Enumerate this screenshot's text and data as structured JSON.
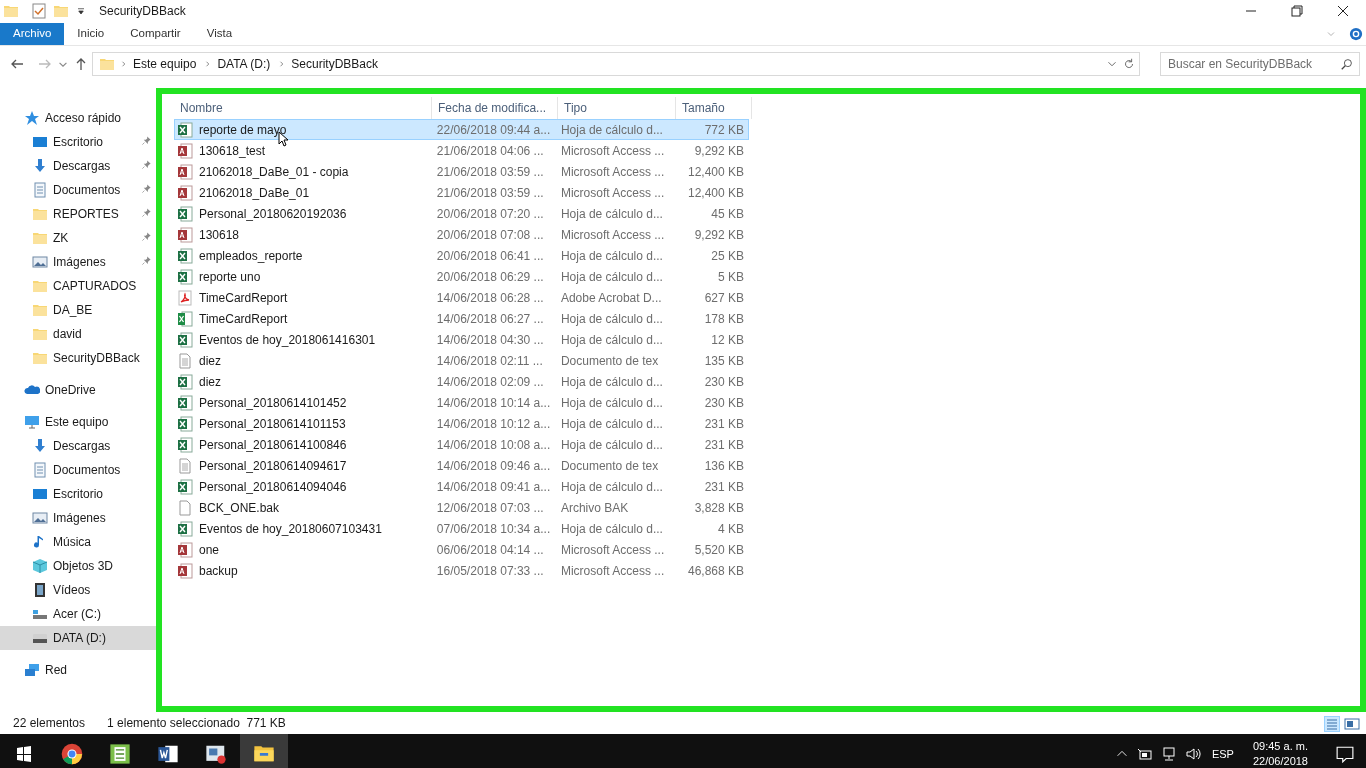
{
  "window": {
    "title": "SecurityDBBack"
  },
  "ribbon_tabs": [
    {
      "label": "Archivo",
      "selected": true
    },
    {
      "label": "Inicio",
      "selected": false
    },
    {
      "label": "Compartir",
      "selected": false
    },
    {
      "label": "Vista",
      "selected": false
    }
  ],
  "address": {
    "crumbs": [
      "Este equipo",
      "DATA (D:)",
      "SecurityDBBack"
    ]
  },
  "search": {
    "placeholder": "Buscar en SecurityDBBack"
  },
  "sidebar": {
    "items": [
      {
        "label": "Acceso rápido",
        "kind": "star",
        "selected": false,
        "children": [
          {
            "label": "Escritorio",
            "kind": "desktop",
            "pinned": true,
            "selected": false
          },
          {
            "label": "Descargas",
            "kind": "download",
            "pinned": true,
            "selected": false
          },
          {
            "label": "Documentos",
            "kind": "docs",
            "pinned": true,
            "selected": false
          },
          {
            "label": "REPORTES",
            "kind": "folder",
            "pinned": true,
            "selected": false
          },
          {
            "label": "ZK",
            "kind": "folder",
            "pinned": true,
            "selected": false
          },
          {
            "label": "Imágenes",
            "kind": "pictures",
            "pinned": true,
            "selected": false
          },
          {
            "label": "CAPTURADOS",
            "kind": "folder",
            "pinned": false,
            "selected": false
          },
          {
            "label": "DA_BE",
            "kind": "folder",
            "pinned": false,
            "selected": false
          },
          {
            "label": "david",
            "kind": "folder",
            "pinned": false,
            "selected": false
          },
          {
            "label": "SecurityDBBack",
            "kind": "folder",
            "pinned": false,
            "selected": false
          }
        ]
      },
      {
        "label": "OneDrive",
        "kind": "cloud",
        "selected": false
      },
      {
        "label": "Este equipo",
        "kind": "pc",
        "selected": false,
        "children": [
          {
            "label": "Descargas",
            "kind": "download",
            "pinned": false,
            "selected": false
          },
          {
            "label": "Documentos",
            "kind": "docs",
            "pinned": false,
            "selected": false
          },
          {
            "label": "Escritorio",
            "kind": "desktop",
            "pinned": false,
            "selected": false
          },
          {
            "label": "Imágenes",
            "kind": "pictures",
            "pinned": false,
            "selected": false
          },
          {
            "label": "Música",
            "kind": "music",
            "pinned": false,
            "selected": false
          },
          {
            "label": "Objetos 3D",
            "kind": "cube",
            "pinned": false,
            "selected": false
          },
          {
            "label": "Vídeos",
            "kind": "video",
            "pinned": false,
            "selected": false
          },
          {
            "label": "Acer (C:)",
            "kind": "drive-c",
            "pinned": false,
            "selected": false
          },
          {
            "label": "DATA (D:)",
            "kind": "drive",
            "pinned": false,
            "selected": true
          }
        ]
      },
      {
        "label": "Red",
        "kind": "network",
        "selected": false
      }
    ]
  },
  "table": {
    "columns": [
      "Nombre",
      "Fecha de modifica...",
      "Tipo",
      "Tamaño"
    ],
    "rows": [
      {
        "kind": "xlsx",
        "name": "reporte de mayo",
        "date": "22/06/2018 09:44 a...",
        "type": "Hoja de cálculo d...",
        "size": "772 KB",
        "selected": true
      },
      {
        "kind": "access",
        "name": "130618_test",
        "date": "21/06/2018 04:06 ...",
        "type": "Microsoft Access ...",
        "size": "9,292 KB",
        "selected": false
      },
      {
        "kind": "access",
        "name": "21062018_DaBe_01 - copia",
        "date": "21/06/2018 03:59 ...",
        "type": "Microsoft Access ...",
        "size": "12,400 KB",
        "selected": false
      },
      {
        "kind": "access",
        "name": "21062018_DaBe_01",
        "date": "21/06/2018 03:59 ...",
        "type": "Microsoft Access ...",
        "size": "12,400 KB",
        "selected": false
      },
      {
        "kind": "xlsx",
        "name": "Personal_20180620192036",
        "date": "20/06/2018 07:20 ...",
        "type": "Hoja de cálculo d...",
        "size": "45 KB",
        "selected": false
      },
      {
        "kind": "access",
        "name": "130618",
        "date": "20/06/2018 07:08 ...",
        "type": "Microsoft Access ...",
        "size": "9,292 KB",
        "selected": false
      },
      {
        "kind": "xlsx",
        "name": "empleados_reporte",
        "date": "20/06/2018 06:41 ...",
        "type": "Hoja de cálculo d...",
        "size": "25 KB",
        "selected": false
      },
      {
        "kind": "xlsx",
        "name": "reporte uno",
        "date": "20/06/2018 06:29 ...",
        "type": "Hoja de cálculo d...",
        "size": "5 KB",
        "selected": false
      },
      {
        "kind": "pdf",
        "name": "TimeCardReport",
        "date": "14/06/2018 06:28 ...",
        "type": "Adobe Acrobat D...",
        "size": "627 KB",
        "selected": false
      },
      {
        "kind": "xls",
        "name": "TimeCardReport",
        "date": "14/06/2018 06:27 ...",
        "type": "Hoja de cálculo d...",
        "size": "178 KB",
        "selected": false
      },
      {
        "kind": "xlsx",
        "name": "Eventos de hoy_2018061416301",
        "date": "14/06/2018 04:30 ...",
        "type": "Hoja de cálculo d...",
        "size": "12 KB",
        "selected": false
      },
      {
        "kind": "txt",
        "name": "diez",
        "date": "14/06/2018 02:11 ...",
        "type": "Documento de tex",
        "size": "135 KB",
        "selected": false
      },
      {
        "kind": "xlsx",
        "name": "diez",
        "date": "14/06/2018 02:09 ...",
        "type": "Hoja de cálculo d...",
        "size": "230 KB",
        "selected": false
      },
      {
        "kind": "xlsx",
        "name": "Personal_20180614101452",
        "date": "14/06/2018 10:14 a...",
        "type": "Hoja de cálculo d...",
        "size": "230 KB",
        "selected": false
      },
      {
        "kind": "xlsx",
        "name": "Personal_20180614101153",
        "date": "14/06/2018 10:12 a...",
        "type": "Hoja de cálculo d...",
        "size": "231 KB",
        "selected": false
      },
      {
        "kind": "xlsx",
        "name": "Personal_20180614100846",
        "date": "14/06/2018 10:08 a...",
        "type": "Hoja de cálculo d...",
        "size": "231 KB",
        "selected": false
      },
      {
        "kind": "txt",
        "name": "Personal_20180614094617",
        "date": "14/06/2018 09:46 a...",
        "type": "Documento de tex",
        "size": "136 KB",
        "selected": false
      },
      {
        "kind": "xlsx",
        "name": "Personal_20180614094046",
        "date": "14/06/2018 09:41 a...",
        "type": "Hoja de cálculo d...",
        "size": "231 KB",
        "selected": false
      },
      {
        "kind": "file",
        "name": "BCK_ONE.bak",
        "date": "12/06/2018 07:03 ...",
        "type": "Archivo BAK",
        "size": "3,828 KB",
        "selected": false
      },
      {
        "kind": "xlsx",
        "name": "Eventos de hoy_20180607103431",
        "date": "07/06/2018 10:34 a...",
        "type": "Hoja de cálculo d...",
        "size": "4 KB",
        "selected": false
      },
      {
        "kind": "access",
        "name": "one",
        "date": "06/06/2018 04:14 ...",
        "type": "Microsoft Access ...",
        "size": "5,520 KB",
        "selected": false
      },
      {
        "kind": "access",
        "name": "backup",
        "date": "16/05/2018 07:33 ...",
        "type": "Microsoft Access ...",
        "size": "46,868 KB",
        "selected": false
      }
    ]
  },
  "status_bar": {
    "count": "22 elementos",
    "selection": "1 elemento seleccionado  771 KB"
  },
  "taskbar": {
    "apps": [
      {
        "kind": "chrome",
        "selected": false
      },
      {
        "kind": "sheet",
        "selected": false
      },
      {
        "kind": "word",
        "selected": false
      },
      {
        "kind": "app",
        "selected": false
      },
      {
        "kind": "explorer",
        "selected": true
      }
    ],
    "language": "ESP",
    "time": "09:45 a. m.",
    "date": "22/06/2018"
  }
}
